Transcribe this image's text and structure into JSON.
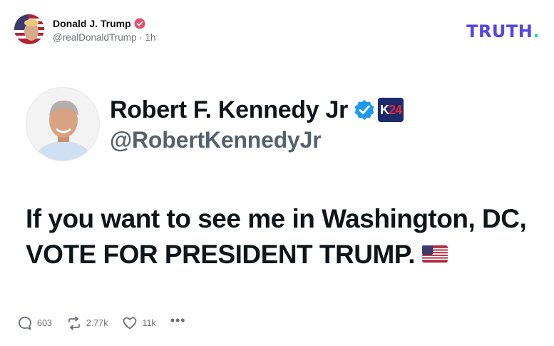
{
  "post": {
    "author_name": "Donald J. Trump",
    "handle": "@realDonaldTrump",
    "separator": "·",
    "time": "1h"
  },
  "brand": {
    "logo_text": "TRUTH",
    "logo_dot": "."
  },
  "embedded": {
    "name": "Robert F. Kennedy Jr",
    "handle": "@RobertKennedyJr",
    "badge_k": "K",
    "badge_24": "24",
    "text": "If you want to see me in Washington, DC, VOTE FOR PRESIDENT TRUMP."
  },
  "actions": {
    "replies": "603",
    "retruths": "2.77k",
    "likes": "11k",
    "more": "•••"
  },
  "colors": {
    "truth_purple": "#5446e5",
    "truth_teal": "#2fd3b2",
    "verified_blue": "#1d9bf0",
    "badge_red": "#ea4c6b"
  }
}
